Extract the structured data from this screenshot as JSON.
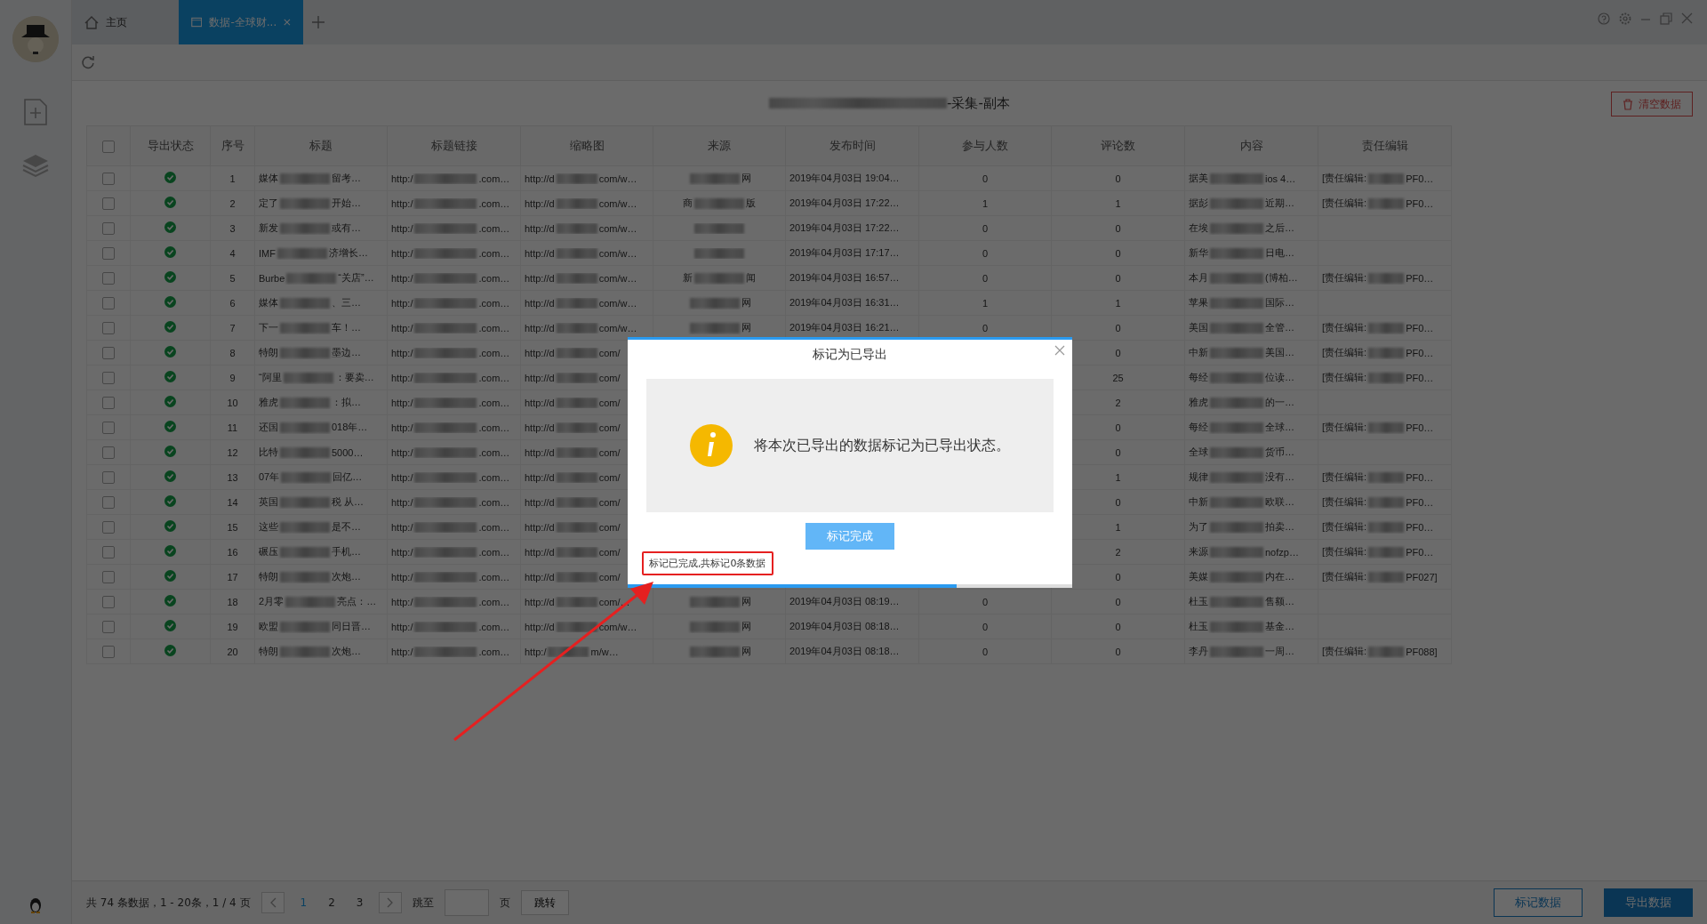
{
  "tabs": [
    {
      "label": "主页",
      "kind": "home",
      "selected": false,
      "closable": false
    },
    {
      "label": "数据-全球财...",
      "kind": "data",
      "selected": true,
      "closable": true
    }
  ],
  "page_title": "-采集-副本",
  "clear_button": "清空数据",
  "table": {
    "header_checked": false,
    "columns": [
      "导出状态",
      "序号",
      "标题",
      "标题链接",
      "缩略图",
      "来源",
      "发布时间",
      "参与人数",
      "评论数",
      "内容",
      "责任编辑"
    ],
    "rows": [
      {
        "checked": false,
        "exported": true,
        "seq": "1",
        "title": {
          "start": "媒体",
          "end": "留考…"
        },
        "link": {
          "start": "http:/",
          "end": ".com…"
        },
        "thumb": {
          "start": "http://d",
          "end": "com/w…"
        },
        "source": {
          "end": "网"
        },
        "time": "2019年04月03日 19:04…",
        "participants": "0",
        "comments": "0",
        "content": {
          "start": "据美",
          "end": "ios 4…"
        },
        "editor": {
          "start": "[责任编辑:",
          "end": "PF0…"
        }
      },
      {
        "checked": false,
        "exported": true,
        "seq": "2",
        "title": {
          "start": "定了",
          "end": "开始…"
        },
        "link": {
          "start": "http:/",
          "end": ".com…"
        },
        "thumb": {
          "start": "http://d",
          "end": "com/w…"
        },
        "source": {
          "start": "商",
          "end": "版"
        },
        "time": "2019年04月03日 17:22…",
        "participants": "1",
        "comments": "1",
        "content": {
          "start": "据彭",
          "end": "近期…"
        },
        "editor": {
          "start": "[责任编辑:",
          "end": "PF0…"
        }
      },
      {
        "checked": false,
        "exported": true,
        "seq": "3",
        "title": {
          "start": "新发",
          "end": "或有…"
        },
        "link": {
          "start": "http:/",
          "end": ".com…"
        },
        "thumb": {
          "start": "http://d",
          "end": "com/w…"
        },
        "source": {},
        "time": "2019年04月03日 17:22…",
        "participants": "0",
        "comments": "0",
        "content": {
          "start": "在埃",
          "end": "之后…"
        }
      },
      {
        "checked": false,
        "exported": true,
        "seq": "4",
        "title": {
          "start": "IMF",
          "end": "济增长…"
        },
        "link": {
          "start": "http:/",
          "end": ".com…"
        },
        "thumb": {
          "start": "http://d",
          "end": "com/w…"
        },
        "source": {},
        "time": "2019年04月03日 17:17…",
        "participants": "0",
        "comments": "0",
        "content": {
          "start": "新华",
          "end": "日电…"
        }
      },
      {
        "checked": false,
        "exported": true,
        "seq": "5",
        "title": {
          "start": "Burbe",
          "end": "“关店”…"
        },
        "link": {
          "start": "http:/",
          "end": ".com…"
        },
        "thumb": {
          "start": "http://d",
          "end": "com/w…"
        },
        "source": {
          "start": "新",
          "end": "闻"
        },
        "time": "2019年04月03日 16:57…",
        "participants": "0",
        "comments": "0",
        "content": {
          "start": "本月",
          "end": "(博柏…"
        },
        "editor": {
          "start": "[责任编辑:",
          "end": "PF0…"
        }
      },
      {
        "checked": false,
        "exported": true,
        "seq": "6",
        "title": {
          "start": "媒体",
          "end": "、三…"
        },
        "link": {
          "start": "http:/",
          "end": ".com…"
        },
        "thumb": {
          "start": "http://d",
          "end": "com/w…"
        },
        "source": {
          "end": "网"
        },
        "time": "2019年04月03日 16:31…",
        "participants": "1",
        "comments": "1",
        "content": {
          "start": "苹果",
          "end": "国际…"
        }
      },
      {
        "checked": false,
        "exported": true,
        "seq": "7",
        "title": {
          "start": "下一",
          "end": "车！…"
        },
        "link": {
          "start": "http:/",
          "end": ".com…"
        },
        "thumb": {
          "start": "http://d",
          "end": "com/w…"
        },
        "source": {
          "end": "网"
        },
        "time": "2019年04月03日 16:21…",
        "participants": "0",
        "comments": "0",
        "content": {
          "start": "美国",
          "end": "全管…"
        },
        "editor": {
          "start": "[责任编辑:",
          "end": "PF0…"
        }
      },
      {
        "checked": false,
        "exported": true,
        "seq": "8",
        "title": {
          "start": "特朗",
          "end": "墨边…"
        },
        "link": {
          "start": "http:/",
          "end": ".com…"
        },
        "thumb": {
          "start": "http://d",
          "end": "com/"
        },
        "comments": "0",
        "content": {
          "start": "中新",
          "end": "美国…"
        },
        "editor": {
          "start": "[责任编辑:",
          "end": "PF0…"
        }
      },
      {
        "checked": false,
        "exported": true,
        "seq": "9",
        "title": {
          "start": "“阿里",
          "end": "：要卖…"
        },
        "link": {
          "start": "http:/",
          "end": ".com…"
        },
        "thumb": {
          "start": "http://d",
          "end": "com/"
        },
        "comments": "25",
        "content": {
          "start": "每经",
          "end": "位读…"
        },
        "editor": {
          "start": "[责任编辑:",
          "end": "PF0…"
        }
      },
      {
        "checked": false,
        "exported": true,
        "seq": "10",
        "title": {
          "start": "雅虎",
          "end": "：拟…"
        },
        "link": {
          "start": "http:/",
          "end": ".com…"
        },
        "thumb": {
          "start": "http://d",
          "end": "com/"
        },
        "comments": "2",
        "content": {
          "start": "雅虎",
          "end": "的一…"
        }
      },
      {
        "checked": false,
        "exported": true,
        "seq": "11",
        "title": {
          "start": "还国",
          "end": "018年…"
        },
        "link": {
          "start": "http:/",
          "end": ".com…"
        },
        "thumb": {
          "start": "http://d",
          "end": "com/"
        },
        "comments": "0",
        "content": {
          "start": "每经",
          "end": "全球…"
        },
        "editor": {
          "start": "[责任编辑:",
          "end": "PF0…"
        }
      },
      {
        "checked": false,
        "exported": true,
        "seq": "12",
        "title": {
          "start": "比特",
          "end": "5000…"
        },
        "link": {
          "start": "http:/",
          "end": ".com…"
        },
        "thumb": {
          "start": "http://d",
          "end": "com/"
        },
        "comments": "0",
        "content": {
          "start": "全球",
          "end": "货币…"
        }
      },
      {
        "checked": false,
        "exported": true,
        "seq": "13",
        "title": {
          "start": "07年",
          "end": "回亿…"
        },
        "link": {
          "start": "http:/",
          "end": ".com…"
        },
        "thumb": {
          "start": "http://d",
          "end": "com/"
        },
        "comments": "1",
        "content": {
          "start": "规律",
          "end": "没有…"
        },
        "editor": {
          "start": "[责任编辑:",
          "end": "PF0…"
        }
      },
      {
        "checked": false,
        "exported": true,
        "seq": "14",
        "title": {
          "start": "英国",
          "end": "税 从…"
        },
        "link": {
          "start": "http:/",
          "end": ".com…"
        },
        "thumb": {
          "start": "http://d",
          "end": "com/"
        },
        "comments": "0",
        "content": {
          "start": "中新",
          "end": "欧联…"
        },
        "editor": {
          "start": "[责任编辑:",
          "end": "PF0…"
        }
      },
      {
        "checked": false,
        "exported": true,
        "seq": "15",
        "title": {
          "start": "这些",
          "end": "是不…"
        },
        "link": {
          "start": "http:/",
          "end": ".com…"
        },
        "thumb": {
          "start": "http://d",
          "end": "com/"
        },
        "comments": "1",
        "content": {
          "start": "为了",
          "end": "拍卖…"
        },
        "editor": {
          "start": "[责任编辑:",
          "end": "PF0…"
        }
      },
      {
        "checked": false,
        "exported": true,
        "seq": "16",
        "title": {
          "start": "碾压",
          "end": "手机…"
        },
        "link": {
          "start": "http:/",
          "end": ".com…"
        },
        "thumb": {
          "start": "http://d",
          "end": "com/"
        },
        "comments": "2",
        "content": {
          "start": "来源",
          "end": "nofzp…"
        },
        "editor": {
          "start": "[责任编辑:",
          "end": "PF0…"
        }
      },
      {
        "checked": false,
        "exported": true,
        "seq": "17",
        "title": {
          "start": "特朗",
          "end": "次炮…"
        },
        "link": {
          "start": "http:/",
          "end": ".com…"
        },
        "thumb": {
          "start": "http://d",
          "end": "com/"
        },
        "comments": "0",
        "content": {
          "start": "美媒",
          "end": "内在…"
        },
        "editor": {
          "start": "[责任编辑:",
          "end": "PF027]"
        }
      },
      {
        "checked": false,
        "exported": true,
        "seq": "18",
        "title": {
          "start": "2月零",
          "end": "亮点：…"
        },
        "link": {
          "start": "http:/",
          "end": ".com…"
        },
        "thumb": {
          "start": "http://d",
          "end": "com/…"
        },
        "source": {
          "end": "网"
        },
        "time": "2019年04月03日 08:19…",
        "participants": "0",
        "comments": "0",
        "content": {
          "start": "杜玉",
          "end": "售额…"
        }
      },
      {
        "checked": false,
        "exported": true,
        "seq": "19",
        "title": {
          "start": "欧盟",
          "end": "同日晋…"
        },
        "link": {
          "start": "http:/",
          "end": ".com…"
        },
        "thumb": {
          "start": "http://d",
          "end": "com/w…"
        },
        "source": {
          "end": "网"
        },
        "time": "2019年04月03日 08:18…",
        "participants": "0",
        "comments": "0",
        "content": {
          "start": "杜玉",
          "end": "基金…"
        }
      },
      {
        "checked": false,
        "exported": true,
        "seq": "20",
        "title": {
          "start": "特朗",
          "end": "次炮…"
        },
        "link": {
          "start": "http:/",
          "end": ".com…"
        },
        "thumb": {
          "start": "http:/",
          "end": "m/w…"
        },
        "source": {
          "end": "网"
        },
        "time": "2019年04月03日 08:18…",
        "participants": "0",
        "comments": "0",
        "content": {
          "start": "李丹",
          "end": "一周…"
        },
        "editor": {
          "start": "[责任编辑:",
          "end": "PF088]"
        }
      }
    ]
  },
  "pagination": {
    "summary": "共 74 条数据，1 - 20条，1 / 4 页",
    "pages": [
      {
        "label": "1",
        "selected": true
      },
      {
        "label": "2",
        "selected": false
      },
      {
        "label": "3",
        "selected": false
      }
    ],
    "goto_label": "跳至",
    "page_unit": "页",
    "goto_button": "跳转"
  },
  "footer_buttons": [
    {
      "label": "标记数据",
      "kind": "outline"
    },
    {
      "label": "导出数据",
      "kind": "primary"
    }
  ],
  "dialog": {
    "title": "标记为已导出",
    "message": "将本次已导出的数据标记为已导出状态。",
    "button": "标记完成",
    "status": "标记已完成,共标记0条数据",
    "progress": {
      "level": 0.74
    }
  }
}
